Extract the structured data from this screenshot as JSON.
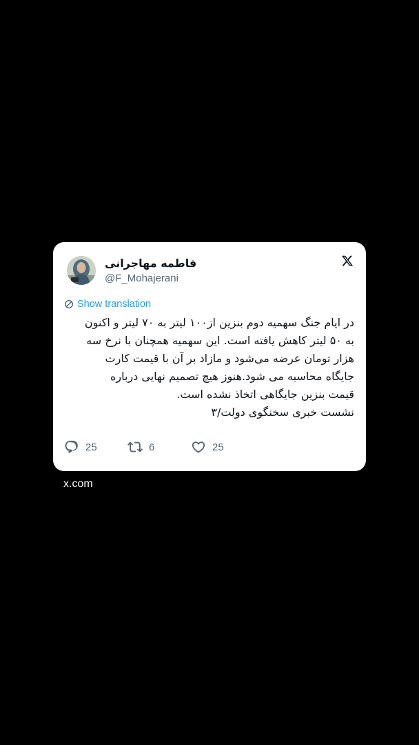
{
  "tweet": {
    "author": {
      "display_name": "فاطمه مهاجرانی",
      "handle": "@F_Mohajerani"
    },
    "translate_label": "Show translation",
    "text_lines": [
      "در ایام جنگ سهمیه دوم بنزین از۱۰۰ لیتر  به ۷۰ لیتر و اکنون",
      "به ۵۰ لیتر کاهش یافته است. این سهمیه همچنان با نرخ سه",
      "هزار تومان عرضه می‌شود و مازاد بر آن با قیمت کارت",
      "جایگاه محاسبه می شود.هنوز هیچ تصمیم نهایی درباره",
      "قیمت بنزین جایگاهی اتخاذ نشده است.",
      "نشست خبری سخنگوی دولت/۳"
    ],
    "stats": {
      "replies": "25",
      "reposts": "6",
      "likes": "25"
    },
    "brand_icon": "x-logo-icon"
  },
  "footer": {
    "source": "x.com"
  },
  "colors": {
    "background": "#000000",
    "card": "#ffffff",
    "text": "#0f1419",
    "secondary": "#536471",
    "link": "#1d9bf0"
  }
}
